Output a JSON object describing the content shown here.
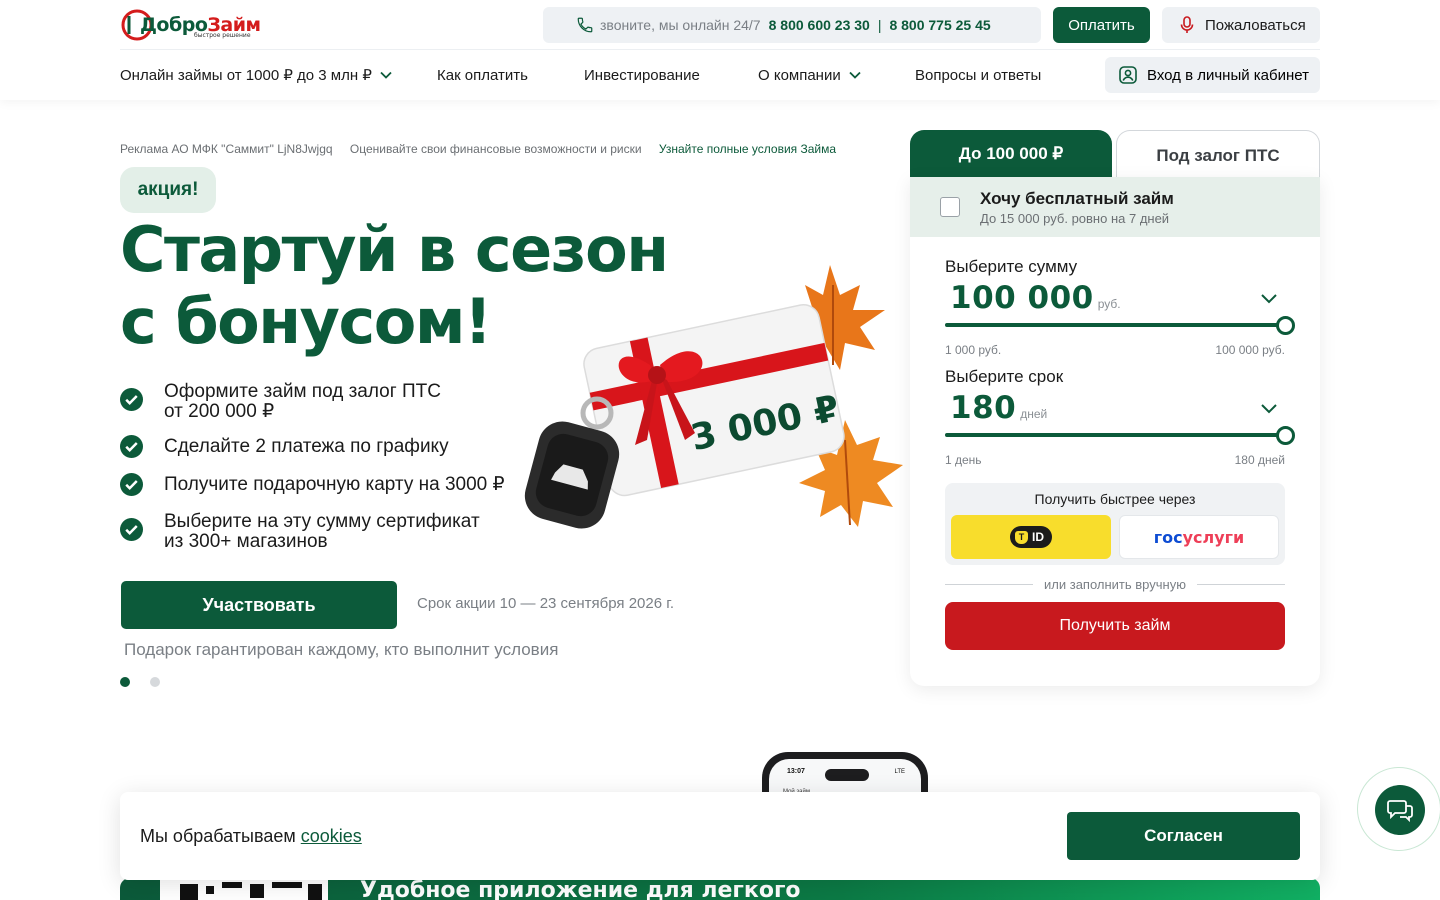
{
  "brand": {
    "name_part1": "Добро",
    "name_part2": "Займ",
    "tagline": "быстрое решение",
    "colors": {
      "primary": "#0c5a3a",
      "accent_red": "#c8191e"
    }
  },
  "header": {
    "contact_text": "звоните, мы онлайн 24/7",
    "phone1": "8 800 600 23 30",
    "phone_separator": "|",
    "phone2": "8 800 775 25 45",
    "pay_button": "Оплатить",
    "complain_button": "Пожаловаться",
    "cabinet_button": "Вход в личный кабинет"
  },
  "nav": {
    "items": [
      {
        "label": "Онлайн займы от 1000 ₽ до 3 млн ₽",
        "dropdown": true
      },
      {
        "label": "Как оплатить",
        "dropdown": false
      },
      {
        "label": "Инвестирование",
        "dropdown": false
      },
      {
        "label": "О компании",
        "dropdown": true
      },
      {
        "label": "Вопросы и ответы",
        "dropdown": false
      }
    ]
  },
  "hero": {
    "ad_notice": "Реклама АО МФК \"Саммит\" LjN8Jwjgq",
    "risk_notice": "Оценивайте свои финансовые возможности и риски",
    "terms_link": "Узнайте полные условия Займа",
    "badge": "акция!",
    "title_line1": "Стартуй в сезон",
    "title_line2": "с бонусом!",
    "checklist": [
      {
        "line1": "Оформите займ под залог ПТС",
        "line2": "от 200 000 ₽"
      },
      {
        "line1": "Сделайте 2 платежа по графику",
        "line2": ""
      },
      {
        "line1": "Получите подарочную карту на 3000 ₽",
        "line2": ""
      },
      {
        "line1": "Выберите на эту сумму сертификат",
        "line2": "из 300+ магазинов"
      }
    ],
    "cta_button": "Участвовать",
    "promo_dates": "Срок акции 10 — 23 сентября 2026 г.",
    "gift_note": "Подарок гарантирован каждому, кто выполнит условия",
    "gift_card_amount": "3 000 ₽",
    "slides_total": 2,
    "slide_active": 1
  },
  "calculator": {
    "tabs": [
      {
        "label": "До 100 000 ₽",
        "active": true
      },
      {
        "label": "Под залог ПТС",
        "active": false
      }
    ],
    "free_loan": {
      "title": "Хочу бесплатный займ",
      "subtitle": "До 15 000 руб. ровно на 7 дней",
      "checked": false
    },
    "amount": {
      "label": "Выберите сумму",
      "value": "100 000",
      "unit": "руб.",
      "min_label": "1 000 руб.",
      "max_label": "100 000 руб.",
      "fill": 1.0
    },
    "term": {
      "label": "Выберите срок",
      "value": "180",
      "unit": "дней",
      "min_label": "1 день",
      "max_label": "180 дней",
      "fill": 1.0
    },
    "fast": {
      "title": "Получить быстрее через",
      "tid_label": "ID",
      "gos_part1": "гос",
      "gos_part2": "услуги"
    },
    "or_text": "или заполнить вручную",
    "submit_button": "Получить займ"
  },
  "app_section": {
    "title": "Удобное приложение для легкого"
  },
  "phone_mock": {
    "time": "13:07",
    "status": "LTE",
    "screen_title": "Мой займ"
  },
  "cookie": {
    "text": "Мы обрабатываем",
    "link": "cookies",
    "agree_button": "Согласен"
  },
  "icons": {
    "phone": "phone-icon",
    "mic": "microphone-icon",
    "user": "user-icon",
    "chevron": "chevron-down-icon",
    "check": "check-circle-icon",
    "chat": "chat-icon"
  }
}
